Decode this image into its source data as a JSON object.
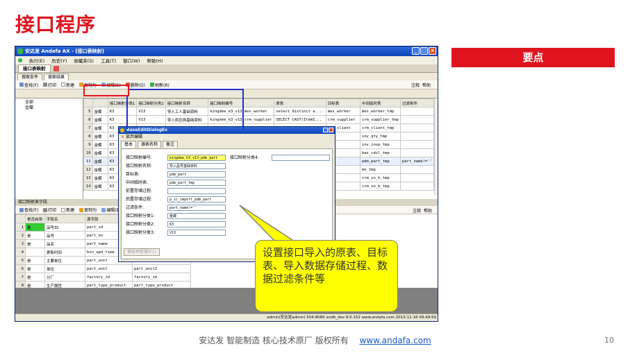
{
  "slide": {
    "title": "接口程序",
    "keypoint": "要点",
    "callout": "设置接口导入的原表、目标表、导入数据存储过程、数据过滤条件等",
    "footer_text": "安达发  智能制造 核心技术原厂  版权所有",
    "footer_link": "www.andafa.com",
    "page_number": "10"
  },
  "app": {
    "title": "安达发 Andafa AX - [接口表映射]",
    "menu": [
      "执行(E)",
      "历史(Y)",
      "收藏夹(S)",
      "工具(T)",
      "窗口(W)",
      "帮助(H)"
    ],
    "doc_tab": "接口表映射",
    "sub_tabs": [
      "搜索条件",
      "搜索结果"
    ],
    "toolbar": [
      "查找(F)",
      "打印",
      "新建",
      "复制为",
      "编辑(E)",
      "删除(D)",
      "刷新(R)"
    ],
    "toolbar_right": [
      "注释",
      "帮助"
    ],
    "tree": [
      "全部",
      "金蝶"
    ],
    "upper_columns": [
      "",
      "接口映射分类1",
      "接口映射分类2",
      "接口映射名称",
      "接口映射编号",
      "原表",
      "目标表",
      "中间临时表",
      "过滤条件"
    ],
    "upper_rows": [
      [
        "5",
        "金蝶",
        "K3",
        "V13",
        "导入工人基础资料",
        "kingdee_k3_v13_mes_worker",
        "select distinct a....",
        "mes_worker",
        "mes_worker_tmp",
        ""
      ],
      [
        "6",
        "金蝶",
        "K3",
        "V13",
        "导入供应商基础资料",
        "kingdee_k3_v13_crm_supplier",
        "SELECT CAST(ItemI...",
        "crm_supplier",
        "crm_supplier_tmp",
        ""
      ],
      [
        "7",
        "金蝶",
        "K3",
        "V13",
        "导入客户基础资料",
        "kingdee_k3_v13_crm_client",
        "SELECT CAST(Empha...",
        "crm_client",
        "crm_client_tmp",
        ""
      ],
      [
        "8",
        "金蝶",
        "K3",
        "V13",
        "",
        "",
        "",
        "",
        "inv_qty_tmp",
        ""
      ],
      [
        "9",
        "金蝶",
        "K3",
        "V13",
        "",
        "",
        "",
        "",
        "inv_invp_tmp",
        ""
      ],
      [
        "10",
        "金蝶",
        "K3",
        "V13",
        "",
        "",
        "",
        "",
        "bas_cdvl_tmp",
        ""
      ],
      [
        "11",
        "金蝶",
        "K3",
        "V13",
        "",
        "",
        "",
        "",
        "pdm_part_tmp",
        "part_name!=''"
      ],
      [
        "12",
        "金蝶",
        "K3",
        "V13",
        "",
        "",
        "",
        "",
        "mo_tmp",
        ""
      ],
      [
        "13",
        "金蝶",
        "K3",
        "V13",
        "",
        "",
        "",
        "",
        "crm_so_h_tmp",
        ""
      ],
      [
        "14",
        "金蝶",
        "K3",
        "V13",
        "",
        "",
        "",
        "",
        "crm_so_b_tmp",
        ""
      ]
    ],
    "lower_header": "接口映射表字段",
    "lower_columns": [
      "",
      "是否启用",
      "字段名",
      "源字段",
      "目标字段"
    ],
    "lower_rows": [
      [
        "1",
        "是",
        "品号ID",
        "part_id",
        ""
      ],
      [
        "2",
        "是",
        "品号",
        "part_no",
        ""
      ],
      [
        "3",
        "是",
        "品名",
        "part_name",
        ""
      ],
      [
        "4",
        "",
        "更新时间",
        "bin_upd_time",
        ""
      ],
      [
        "5",
        "是",
        "主要单位",
        "part_unit",
        ""
      ],
      [
        "6",
        "是",
        "单位",
        "part_unit",
        "part_unit2"
      ],
      [
        "7",
        "是",
        "分厂",
        "factory_id",
        "factory_id"
      ],
      [
        "8",
        "是",
        "生产属性",
        "part_type_product",
        "part_type_product"
      ]
    ],
    "status": "admin(安达发admin)  504:8080  andb_dev  8.0.152  www.andafa.com  2013-11-16 09:49:59"
  },
  "dialog": {
    "title": "BaseEditDialogEx",
    "tool": "放弃编辑",
    "tabs": [
      "基本",
      "源表名称",
      "备注"
    ],
    "fields": [
      {
        "label": "接口映射编号:",
        "value": "kingdee_k3_v13_pdm_part"
      },
      {
        "label": "接口映射名称:",
        "value": "导入品号基础资料"
      },
      {
        "label": "目标表:",
        "value": "pdm_part"
      },
      {
        "label": "中间临时表:",
        "value": "pdm_part_tmp"
      },
      {
        "label": "前置存储过程:",
        "value": ""
      },
      {
        "label": "后置存储过程:",
        "value": "p_ic_import_pdm_part"
      },
      {
        "label": "过滤条件:",
        "value": "part_name!=''"
      },
      {
        "label": "接口映射分类1:",
        "value": "金蝶"
      },
      {
        "label": "接口映射分类2:",
        "value": "K3"
      },
      {
        "label": "接口映射分类3:",
        "value": "V13"
      }
    ],
    "right_label": "接口映射分类4:",
    "save_button": "保存并新增(F1)"
  }
}
